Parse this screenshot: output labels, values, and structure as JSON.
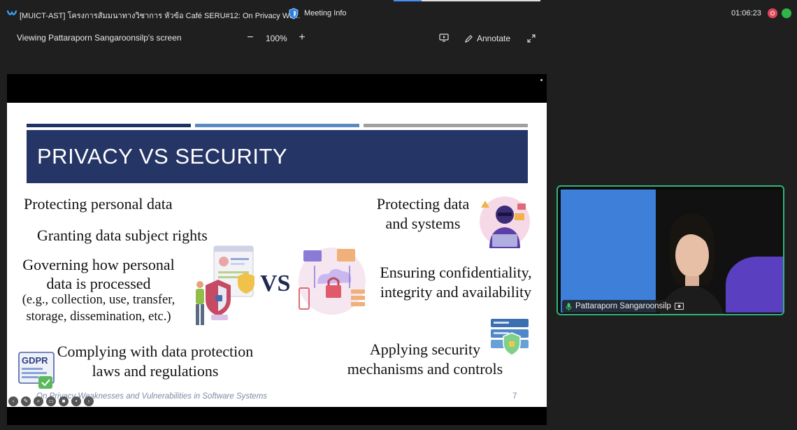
{
  "window": {
    "title": "[MUICT-AST] โครงการสัมมนาทางวิชาการ หัวข้อ Café SERU#12: On Privacy We...",
    "meeting_info": "Meeting Info",
    "elapsed_time": "01:06:23"
  },
  "toolbar": {
    "viewing_label": "Viewing Pattaraporn Sangaroonsilp's screen",
    "zoom_out": "−",
    "zoom_level": "100%",
    "zoom_in": "+",
    "annotate_label": "Annotate"
  },
  "slide": {
    "title": "PRIVACY VS SECURITY",
    "left": {
      "item1": "Protecting personal data",
      "item2": "Granting data subject rights",
      "item3_line1": "Governing how personal",
      "item3_line2": "data is processed",
      "item3_note_line1": "(e.g., collection, use, transfer,",
      "item3_note_line2": "storage, dissemination, etc.)",
      "item4_line1": "Complying with data protection",
      "item4_line2": "laws and regulations"
    },
    "vs": "VS",
    "right": {
      "item1_line1": "Protecting data",
      "item1_line2": "and systems",
      "item2_line1": "Ensuring confidentiality,",
      "item2_line2": "integrity and availability",
      "item3_line1": "Applying security",
      "item3_line2": "mechanisms and controls"
    },
    "gdpr_label": "GDPR",
    "footer": "On Privacy Weaknesses and Vulnerabilities in Software Systems",
    "page_number": "7"
  },
  "video": {
    "participant_name": "Pattaraporn Sangaroonsilp"
  },
  "colors": {
    "title_band": "#253566",
    "bar1": "#203164",
    "bar2": "#5a8abf",
    "bar3": "#a0a0a0",
    "video_border": "#2fb57a"
  }
}
